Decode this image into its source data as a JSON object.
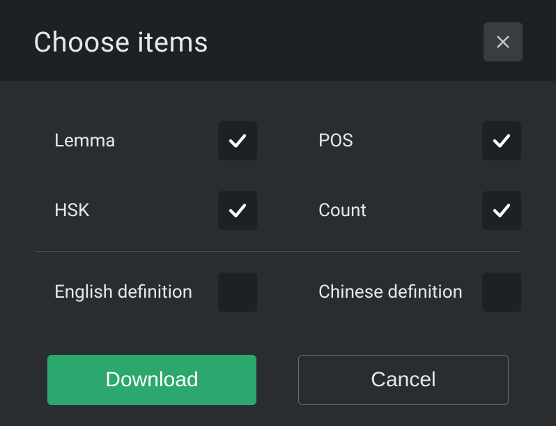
{
  "dialog": {
    "title": "Choose items"
  },
  "options": [
    {
      "label": "Lemma",
      "checked": true
    },
    {
      "label": "POS",
      "checked": true
    },
    {
      "label": "HSK",
      "checked": true
    },
    {
      "label": "Count",
      "checked": true
    },
    {
      "label": "English definition",
      "checked": false
    },
    {
      "label": "Chinese definition",
      "checked": false
    }
  ],
  "buttons": {
    "download": "Download",
    "cancel": "Cancel"
  }
}
